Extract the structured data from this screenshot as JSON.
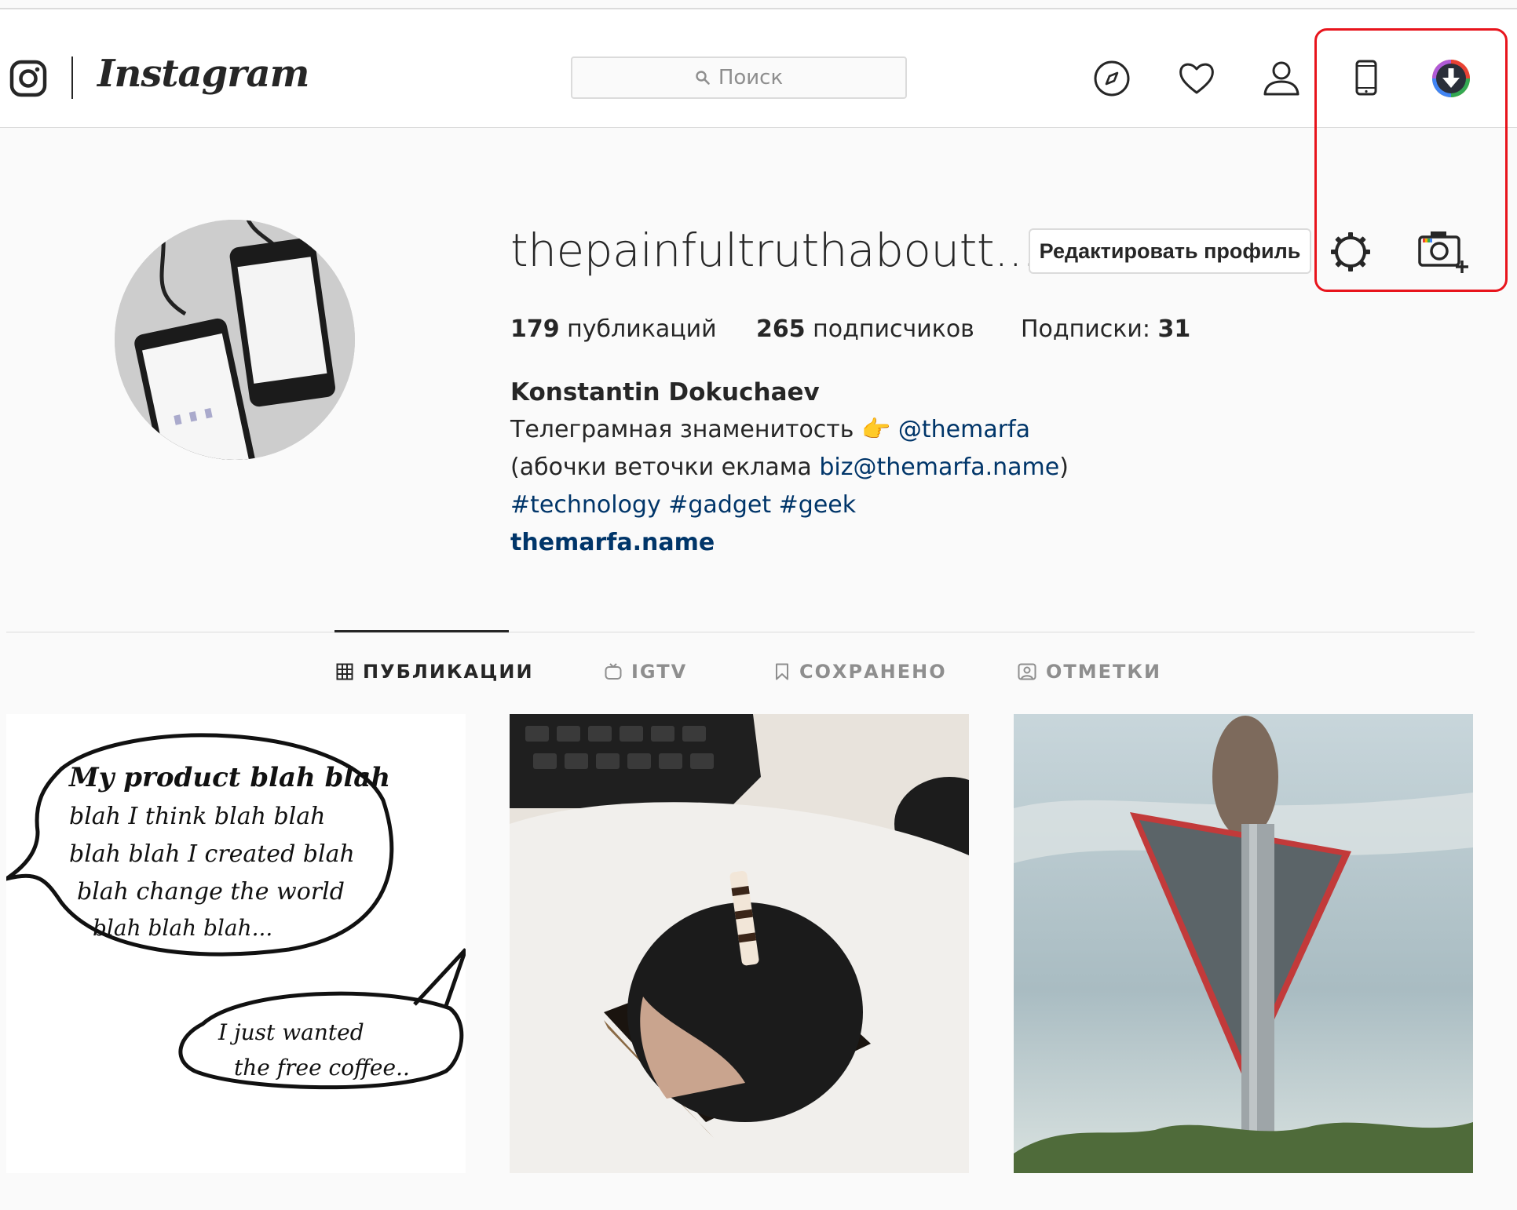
{
  "header": {
    "brand": "Instagram",
    "search_placeholder": "Поиск"
  },
  "profile": {
    "username": "thepainfultruthaboutt...",
    "edit_button": "Редактировать профиль",
    "stats": {
      "posts_count": "179",
      "posts_label": "публикаций",
      "followers_count": "265",
      "followers_label": "подписчиков",
      "following_label": "Подписки:",
      "following_count": "31"
    },
    "bio": {
      "name": "Konstantin Dokuchaev",
      "line1_text": "Телеграмная знаменитость",
      "line1_emoji": "👉",
      "line1_mention": "@themarfa",
      "line2_prefix": "(абочки веточки еклама",
      "line2_email": "biz@themarfa.name",
      "line2_suffix": ")",
      "hashtags": "#technology #gadget #geek",
      "website": "themarfa.name"
    }
  },
  "tabs": [
    {
      "label": "ПУБЛИКАЦИИ",
      "active": true
    },
    {
      "label": "IGTV",
      "active": false
    },
    {
      "label": "СОХРАНЕНО",
      "active": false
    },
    {
      "label": "ОТМЕТКИ",
      "active": false
    }
  ],
  "posts": [
    {
      "description": "comic",
      "bubble1": [
        "My product blah blah",
        "blah I think blah blah",
        "blah blah I created blah",
        "blah change the world",
        "blah blah blah..."
      ],
      "bubble2": [
        "I just wanted",
        "the free coffee.."
      ]
    },
    {
      "description": "dessert"
    },
    {
      "description": "road-sign"
    }
  ],
  "colors": {
    "accent_highlight": "#e8141c",
    "link": "#003569",
    "border": "#dbdbdb",
    "background": "#fafafa"
  }
}
